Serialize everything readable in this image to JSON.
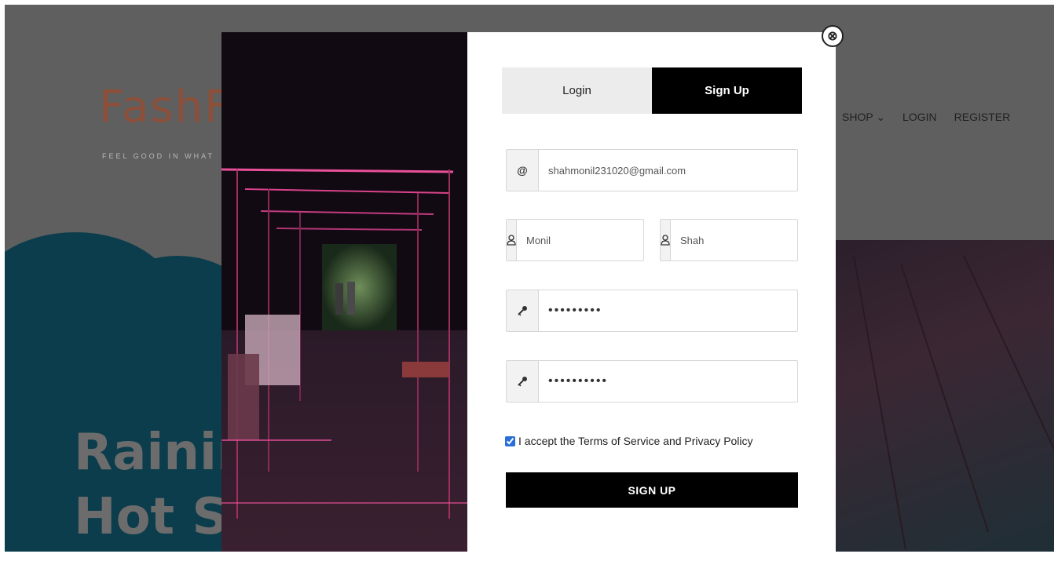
{
  "brand": {
    "logo_text": "FashF",
    "tagline": "FEEL GOOD IN WHAT"
  },
  "hero": {
    "line1": "Raining",
    "line2": "Hot Su"
  },
  "nav": {
    "shop": "SHOP ⌄",
    "login": "LOGIN",
    "register": "REGISTER"
  },
  "modal": {
    "close_icon": "⊗",
    "tabs": {
      "login": "Login",
      "signup": "Sign Up"
    },
    "fields": {
      "email": {
        "icon": "@",
        "value": "shahmonil231020@gmail.com"
      },
      "first_name": {
        "icon": "user-icon",
        "value": "Monil"
      },
      "last_name": {
        "icon": "user-icon",
        "value": "Shah"
      },
      "password": {
        "icon": "key-icon",
        "value": "•••••••••"
      },
      "confirm_password": {
        "icon": "key-icon",
        "value": "••••••••••"
      }
    },
    "terms_label": "I accept the Terms of Service and Privacy Policy",
    "terms_checked": true,
    "submit_label": "SIGN UP"
  },
  "colors": {
    "accent": "#000000",
    "tab_inactive": "#ececec",
    "overlay": "#5f5f5f",
    "checkbox": "#2a6fd6"
  }
}
